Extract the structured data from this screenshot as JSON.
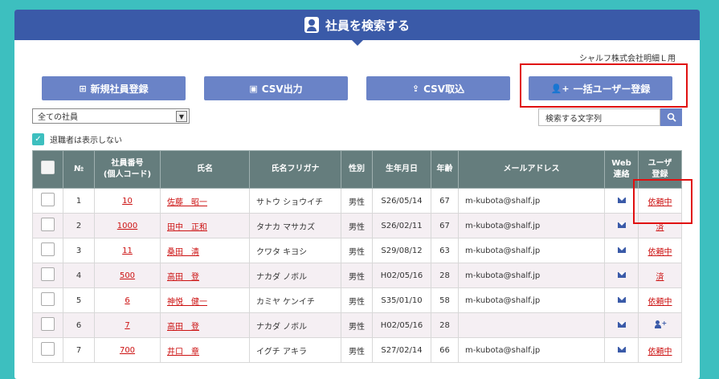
{
  "header": {
    "title": "社員を検索する"
  },
  "company": "シャルフ株式会社明細Ｌ用",
  "buttons": {
    "new_employee": "新規社員登録",
    "csv_export": "CSV出力",
    "csv_import": "CSV取込",
    "bulk_user_register": "一括ユーザー登録"
  },
  "filter": {
    "selected": "全ての社員",
    "search_placeholder": "検索する文字列",
    "hide_retired_label": "退職者は表示しない",
    "hide_retired_checked": true
  },
  "table": {
    "headers": {
      "no": "№",
      "emp_no_1": "社員番号",
      "emp_no_2": "(個人コード)",
      "name": "氏名",
      "kana": "氏名フリガナ",
      "gender": "性別",
      "birth": "生年月日",
      "age": "年齢",
      "email": "メールアドレス",
      "web_1": "Web",
      "web_2": "連絡",
      "user_1": "ユーザ",
      "user_2": "登録"
    },
    "rows": [
      {
        "no": "1",
        "code": "10",
        "name": "佐藤　昭一",
        "kana": "サトウ ショウイチ",
        "gender": "男性",
        "birth": "S26/05/14",
        "age": "67",
        "email": "m-kubota@shalf.jp",
        "web": "mail",
        "status": "依頼中"
      },
      {
        "no": "2",
        "code": "1000",
        "name": "田中　正和",
        "kana": "タナカ マサカズ",
        "gender": "男性",
        "birth": "S26/02/11",
        "age": "67",
        "email": "m-kubota@shalf.jp",
        "web": "mail",
        "status": "済"
      },
      {
        "no": "3",
        "code": "11",
        "name": "桑田　清",
        "kana": "クワタ キヨシ",
        "gender": "男性",
        "birth": "S29/08/12",
        "age": "63",
        "email": "m-kubota@shalf.jp",
        "web": "mail",
        "status": "依頼中"
      },
      {
        "no": "4",
        "code": "500",
        "name": "高田　登",
        "kana": "ナカダ ノボル",
        "gender": "男性",
        "birth": "H02/05/16",
        "age": "28",
        "email": "m-kubota@shalf.jp",
        "web": "mail",
        "status": "済"
      },
      {
        "no": "5",
        "code": "6",
        "name": "神悦　健一",
        "kana": "カミヤ ケンイチ",
        "gender": "男性",
        "birth": "S35/01/10",
        "age": "58",
        "email": "m-kubota@shalf.jp",
        "web": "mail",
        "status": "依頼中"
      },
      {
        "no": "6",
        "code": "7",
        "name": "高田　登",
        "kana": "ナカダ ノボル",
        "gender": "男性",
        "birth": "H02/05/16",
        "age": "28",
        "email": "",
        "web": "mail",
        "status": "add-user-icon"
      },
      {
        "no": "7",
        "code": "700",
        "name": "井口　章",
        "kana": "イグチ アキラ",
        "gender": "男性",
        "birth": "S27/02/14",
        "age": "66",
        "email": "m-kubota@shalf.jp",
        "web": "mail",
        "status": "依頼中"
      }
    ]
  }
}
